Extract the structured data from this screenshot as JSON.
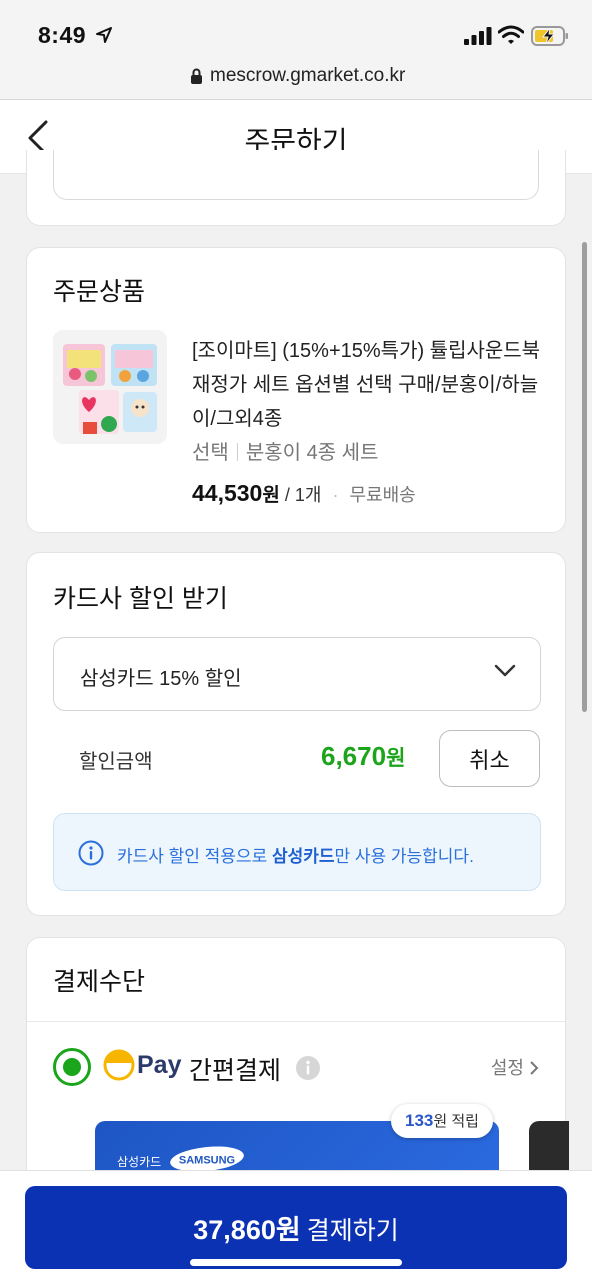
{
  "status_bar": {
    "time": "8:49",
    "icons": [
      "location-arrow-icon",
      "signal-icon",
      "wifi-icon",
      "battery-charging-icon"
    ]
  },
  "browser": {
    "url": "mescrow.gmarket.co.kr"
  },
  "header": {
    "title": "주문하기",
    "back_icon": "chevron-left-icon"
  },
  "order_product": {
    "section_title": "주문상품",
    "name": "[조이마트] (15%+15%특가) 튤립사운드북 재정가 세트 옵션별 선택 구매/분홍이/하늘이/그외4종",
    "option_label": "선택",
    "option_value": "분홍이 4종 세트",
    "price": "44,530",
    "price_unit": "원",
    "quantity": "/ 1개",
    "shipping": "무료배송"
  },
  "card_discount": {
    "section_title": "카드사 할인 받기",
    "selected_card": "삼성카드 15% 할인",
    "discount_label": "할인금액",
    "discount_amount": "6,670",
    "discount_unit": "원",
    "cancel_label": "취소",
    "notice_prefix": "카드사 할인 적용으로 ",
    "notice_bold": "삼성카드",
    "notice_suffix": "만 사용 가능합니다."
  },
  "payment_method": {
    "section_title": "결제수단",
    "pay_brand": "Pay",
    "pay_label": "간편결제",
    "settings_label": "설정",
    "points_amount": "133",
    "points_suffix": "원 적립",
    "card_issuer": "삼성카드",
    "card_brand": "SAMSUNG"
  },
  "checkout": {
    "total_amount": "37,860원",
    "button_label": "결제하기",
    "button_color": "#0b32b2"
  },
  "colors": {
    "accent_green": "#1ca51a",
    "info_blue": "#2a6fdb",
    "brand_navy": "#0b32b2"
  }
}
